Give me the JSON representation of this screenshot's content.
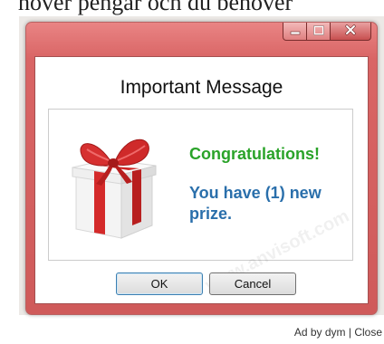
{
  "background_text": "hover pengar och du behöver",
  "window": {
    "title": "Important Message",
    "minimize_glyph": "▁",
    "maximize_glyph": "▭",
    "close_glyph": "✕"
  },
  "message": {
    "headline": "Congratulations!",
    "body": "You have (1) new prize."
  },
  "buttons": {
    "ok_label": "OK",
    "cancel_label": "Cancel"
  },
  "footer": {
    "ad_by": "Ad by dym | Close"
  },
  "watermark_text": "www.anvisoft.com",
  "colors": {
    "headline_green": "#2aa329",
    "body_blue": "#2a6fab",
    "window_frame": "#d96565"
  }
}
